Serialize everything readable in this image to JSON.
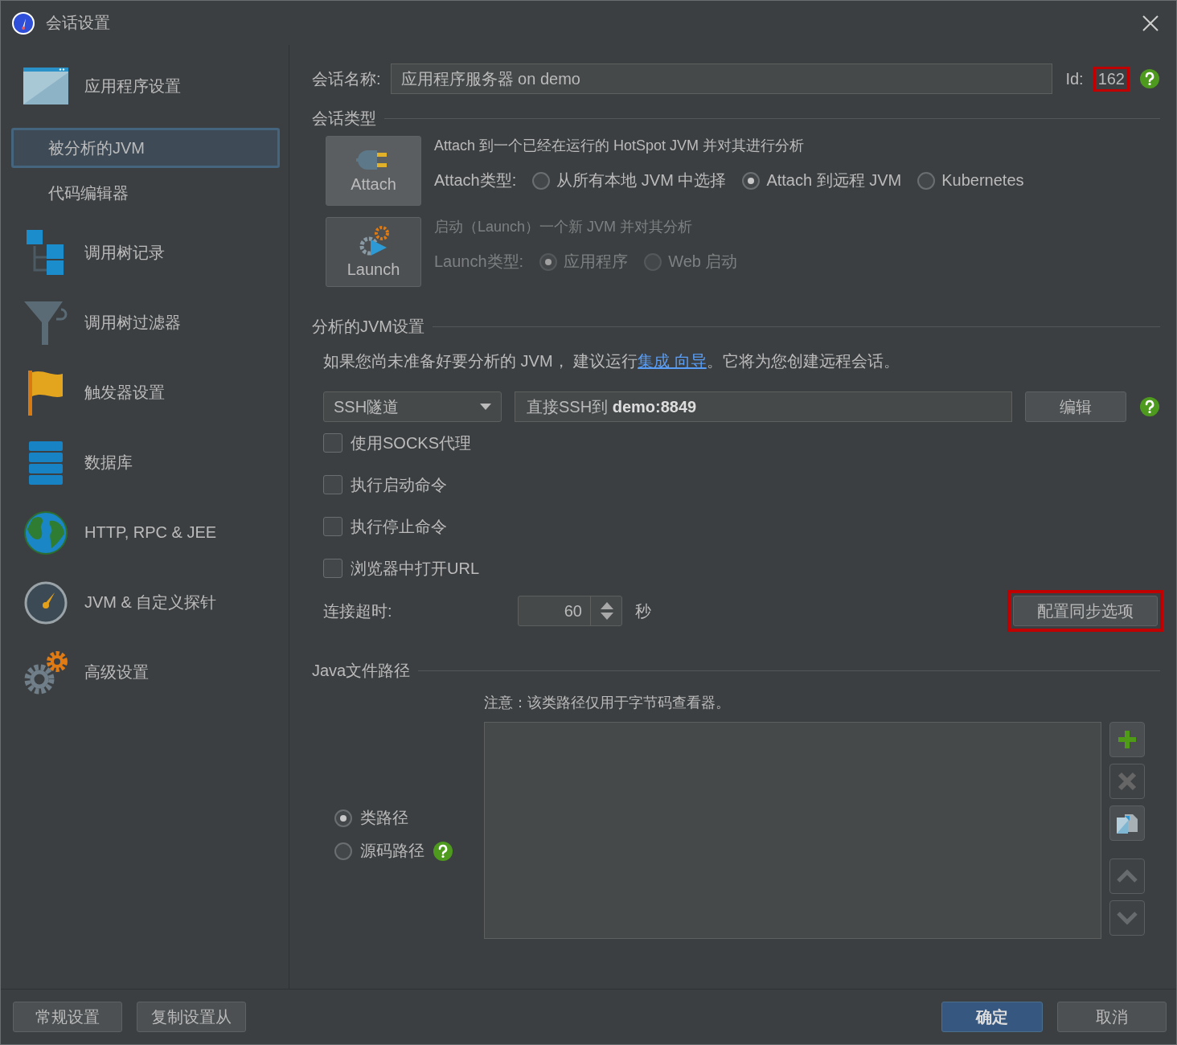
{
  "window": {
    "title": "会话设置"
  },
  "sidebar": {
    "items": [
      {
        "label": "应用程序设置",
        "selected": false,
        "children": [
          {
            "label": "被分析的JVM",
            "selected": true
          },
          {
            "label": "代码编辑器",
            "selected": false
          }
        ]
      },
      {
        "label": "调用树记录",
        "selected": false
      },
      {
        "label": "调用树过滤器",
        "selected": false
      },
      {
        "label": "触发器设置",
        "selected": false
      },
      {
        "label": "数据库",
        "selected": false
      },
      {
        "label": "HTTP, RPC & JEE",
        "selected": false
      },
      {
        "label": "JVM & 自定义探针",
        "selected": false
      },
      {
        "label": "高级设置",
        "selected": false
      }
    ]
  },
  "session_name": {
    "label": "会话名称:",
    "value": "应用程序服务器 on demo"
  },
  "id": {
    "label": "Id:",
    "value": "162",
    "highlighted": true
  },
  "session_type": {
    "title": "会话类型",
    "modes": [
      {
        "label": "Attach",
        "selected": true,
        "disabled": false,
        "description": "Attach 到一个已经在运行的 HotSpot JVM 并对其进行分析",
        "type_label": "Attach类型:",
        "options": [
          {
            "label": "从所有本地 JVM 中选择",
            "selected": false
          },
          {
            "label": "Attach 到远程 JVM",
            "selected": true
          },
          {
            "label": "Kubernetes",
            "selected": false
          }
        ]
      },
      {
        "label": "Launch",
        "selected": false,
        "disabled": true,
        "description": "启动（Launch）一个新 JVM 并对其分析",
        "type_label": "Launch类型:",
        "options": [
          {
            "label": "应用程序",
            "selected": true
          },
          {
            "label": "Web 启动",
            "selected": false
          }
        ]
      }
    ]
  },
  "jvm_settings": {
    "title": "分析的JVM设置",
    "hint_before": "如果您尚未准备好要分析的 JVM， 建议运行",
    "hint_link": "集成 向导",
    "hint_after": "。它将为您创建远程会话。",
    "connection": {
      "value": "SSH隧道"
    },
    "target": "直接SSH到 **demo:8849**",
    "edit_button": "编辑",
    "checkboxes": [
      {
        "label": "使用SOCKS代理",
        "checked": false
      },
      {
        "label": "执行启动命令",
        "checked": false
      },
      {
        "label": "执行停止命令",
        "checked": false
      },
      {
        "label": "浏览器中打开URL",
        "checked": false
      }
    ],
    "timeout": {
      "label": "连接超时:",
      "value": "60",
      "unit": "秒"
    },
    "sync_button": {
      "label": "配置同步选项",
      "highlighted": true
    }
  },
  "java_paths": {
    "title": "Java文件路径",
    "note": "注意：该类路径仅用于字节码查看器。",
    "path_types": [
      {
        "label": "类路径",
        "selected": true,
        "help": false
      },
      {
        "label": "源码路径",
        "selected": false,
        "help": true
      }
    ],
    "tools": [
      {
        "disabled": false
      },
      {
        "disabled": true
      },
      {
        "disabled": false
      },
      {
        "disabled": true
      },
      {
        "disabled": true
      }
    ]
  },
  "footer": {
    "left_buttons": [
      "常规设置",
      "复制设置从"
    ],
    "ok": "确定",
    "cancel": "取消"
  }
}
